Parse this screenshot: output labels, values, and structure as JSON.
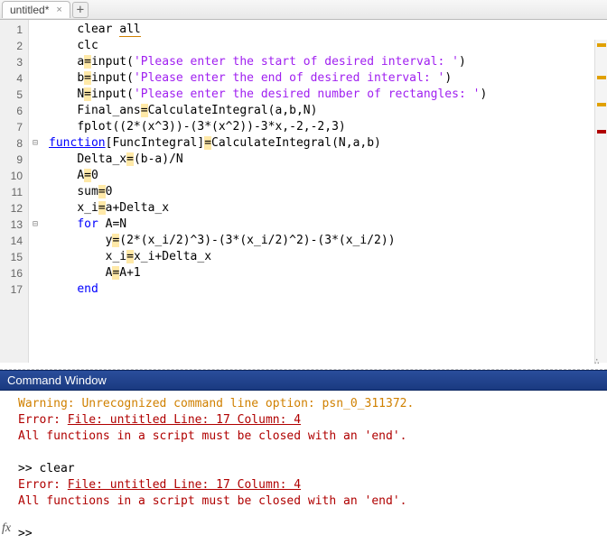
{
  "tabbar": {
    "active_tab": "untitled*",
    "close_glyph": "×",
    "add_glyph": "+"
  },
  "editor": {
    "lines": [
      {
        "n": 1,
        "indent": 1,
        "tokens": [
          {
            "t": "clear ",
            "c": ""
          },
          {
            "t": "all",
            "c": "warn-underline"
          }
        ]
      },
      {
        "n": 2,
        "indent": 1,
        "tokens": [
          {
            "t": "clc",
            "c": ""
          }
        ]
      },
      {
        "n": 3,
        "indent": 1,
        "tokens": [
          {
            "t": "a",
            "c": ""
          },
          {
            "t": "=",
            "c": "hl-eq"
          },
          {
            "t": "input(",
            "c": ""
          },
          {
            "t": "'Please enter the start of desired interval: '",
            "c": "str"
          },
          {
            "t": ")",
            "c": ""
          }
        ]
      },
      {
        "n": 4,
        "indent": 1,
        "tokens": [
          {
            "t": "b",
            "c": ""
          },
          {
            "t": "=",
            "c": "hl-eq"
          },
          {
            "t": "input(",
            "c": ""
          },
          {
            "t": "'Please enter the end of desired interval: '",
            "c": "str"
          },
          {
            "t": ")",
            "c": ""
          }
        ]
      },
      {
        "n": 5,
        "indent": 1,
        "tokens": [
          {
            "t": "N",
            "c": ""
          },
          {
            "t": "=",
            "c": "hl-eq"
          },
          {
            "t": "input(",
            "c": ""
          },
          {
            "t": "'Please enter the desired number of rectangles: '",
            "c": "str"
          },
          {
            "t": ")",
            "c": ""
          }
        ]
      },
      {
        "n": 6,
        "indent": 1,
        "tokens": [
          {
            "t": "Final_ans",
            "c": ""
          },
          {
            "t": "=",
            "c": "hl-eq"
          },
          {
            "t": "CalculateIntegral(a,b,N)",
            "c": ""
          }
        ]
      },
      {
        "n": 7,
        "indent": 1,
        "tokens": [
          {
            "t": "fplot((2*(x^3))-(3*(x^2))-3*x,-2,-2,3)",
            "c": ""
          }
        ]
      },
      {
        "n": 8,
        "indent": 0,
        "fold": "⊟",
        "tokens": [
          {
            "t": "function",
            "c": "fn-decl"
          },
          {
            "t": "[FuncIntegral]",
            "c": ""
          },
          {
            "t": "=",
            "c": "hl-eq"
          },
          {
            "t": "CalculateIntegral(N,a,b)",
            "c": "fn-name"
          }
        ]
      },
      {
        "n": 9,
        "indent": 1,
        "tokens": [
          {
            "t": "Delta_x",
            "c": ""
          },
          {
            "t": "=",
            "c": "hl-eq"
          },
          {
            "t": "(b-a)/N",
            "c": ""
          }
        ]
      },
      {
        "n": 10,
        "indent": 1,
        "tokens": [
          {
            "t": "A",
            "c": ""
          },
          {
            "t": "=",
            "c": "hl-eq"
          },
          {
            "t": "0",
            "c": ""
          }
        ]
      },
      {
        "n": 11,
        "indent": 1,
        "tokens": [
          {
            "t": "sum",
            "c": ""
          },
          {
            "t": "=",
            "c": "hl-eq"
          },
          {
            "t": "0",
            "c": ""
          }
        ]
      },
      {
        "n": 12,
        "indent": 1,
        "tokens": [
          {
            "t": "x_i",
            "c": ""
          },
          {
            "t": "=",
            "c": "hl-eq"
          },
          {
            "t": "a+Delta_x",
            "c": ""
          }
        ]
      },
      {
        "n": 13,
        "indent": 1,
        "fold": "⊟",
        "tokens": [
          {
            "t": "for ",
            "c": "kw"
          },
          {
            "t": "A=N",
            "c": ""
          }
        ]
      },
      {
        "n": 14,
        "indent": 2,
        "tokens": [
          {
            "t": "y",
            "c": ""
          },
          {
            "t": "=",
            "c": "hl-eq"
          },
          {
            "t": "(2*(x_i/2)^3)-(3*(x_i/2)^2)-(3*(x_i/2))",
            "c": ""
          }
        ]
      },
      {
        "n": 15,
        "indent": 2,
        "tokens": [
          {
            "t": "x_i",
            "c": ""
          },
          {
            "t": "=",
            "c": "hl-eq"
          },
          {
            "t": "x_i+Delta_x",
            "c": ""
          }
        ]
      },
      {
        "n": 16,
        "indent": 2,
        "tokens": [
          {
            "t": "A",
            "c": ""
          },
          {
            "t": "=",
            "c": "hl-eq"
          },
          {
            "t": "A+1",
            "c": ""
          }
        ]
      },
      {
        "n": 17,
        "indent": 1,
        "tokens": [
          {
            "t": "end",
            "c": "kw"
          }
        ]
      }
    ]
  },
  "command_window": {
    "title": "Command Window",
    "lines": [
      {
        "text": "Warning: Unrecognized command line option: psn_0_311372.",
        "cls": "cmd-warn"
      },
      {
        "text": "Error: ",
        "link": "File: untitled Line: 17 Column: 4",
        "tail": " ",
        "cls": "cmd-err"
      },
      {
        "text": "All functions in a script must be closed with an 'end'.",
        "cls": "cmd-err"
      },
      {
        "text": "",
        "cls": "cmd-plain"
      },
      {
        "text": ">> clear",
        "cls": "cmd-plain"
      },
      {
        "text": "Error: ",
        "link": "File: untitled Line: 17 Column: 4",
        "tail": " ",
        "cls": "cmd-err"
      },
      {
        "text": "All functions in a script must be closed with an 'end'.",
        "cls": "cmd-err"
      },
      {
        "text": "",
        "cls": "cmd-plain"
      },
      {
        "text": ">> ",
        "cls": "cmd-plain"
      }
    ],
    "fx_glyph": "fx"
  }
}
